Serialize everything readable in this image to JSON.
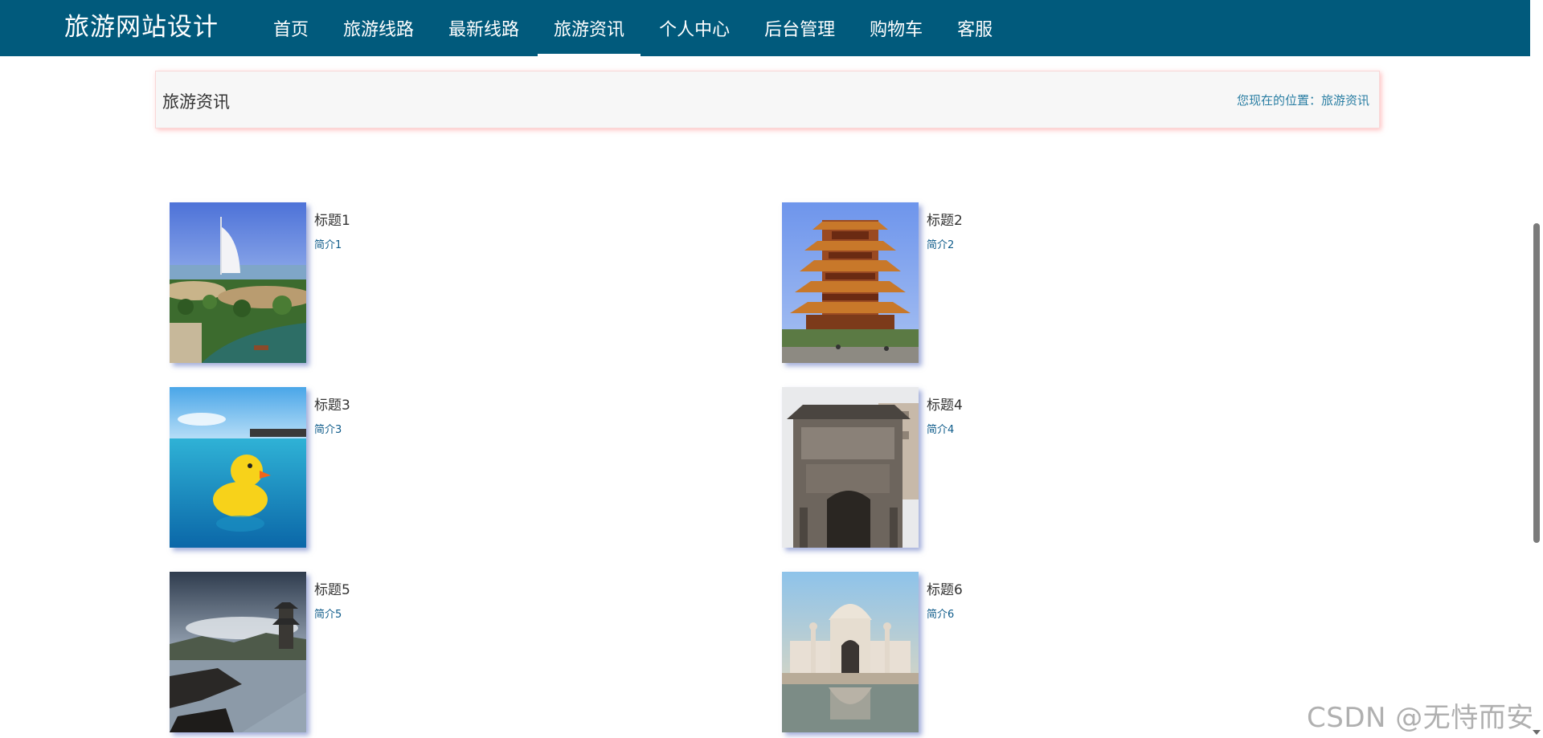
{
  "navbar": {
    "brand": "旅游网站设计",
    "items": [
      {
        "label": "首页",
        "active": false
      },
      {
        "label": "旅游线路",
        "active": false
      },
      {
        "label": "最新线路",
        "active": false
      },
      {
        "label": "旅游资讯",
        "active": true
      },
      {
        "label": "个人中心",
        "active": false
      },
      {
        "label": "后台管理",
        "active": false
      },
      {
        "label": "购物车",
        "active": false
      },
      {
        "label": "客服",
        "active": false
      }
    ],
    "background": "#015a7c"
  },
  "header": {
    "title": "旅游资讯",
    "breadcrumb": "您现在的位置：旅游资讯"
  },
  "news": [
    {
      "title": "标题1",
      "desc": "简介1",
      "image": "burj-al-arab-photo"
    },
    {
      "title": "标题2",
      "desc": "简介2",
      "image": "yellow-crane-tower-photo"
    },
    {
      "title": "标题3",
      "desc": "简介3",
      "image": "rubber-duck-pool-photo"
    },
    {
      "title": "标题4",
      "desc": "简介4",
      "image": "stone-archway-photo"
    },
    {
      "title": "标题5",
      "desc": "简介5",
      "image": "pagoda-lake-photo"
    },
    {
      "title": "标题6",
      "desc": "简介6",
      "image": "taj-mahal-photo"
    }
  ],
  "watermark": "CSDN @无恃而安",
  "colors": {
    "accent": "#015a7c",
    "link": "#2a7ea3",
    "desc": "#0e5b8a"
  }
}
